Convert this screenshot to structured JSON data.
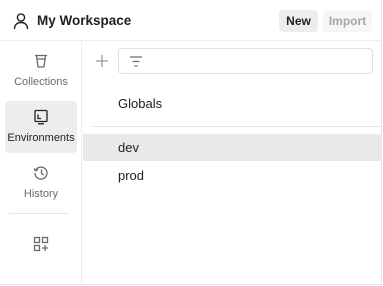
{
  "header": {
    "workspace_title": "My Workspace",
    "new_label": "New",
    "import_label": "Import",
    "workspace_icon": "user-icon"
  },
  "sidebar": {
    "items": [
      {
        "label": "Collections",
        "icon": "trash-can-icon",
        "active": false
      },
      {
        "label": "Environments",
        "icon": "environment-icon",
        "active": true
      },
      {
        "label": "History",
        "icon": "history-icon",
        "active": false
      }
    ],
    "configure_icon": "add-widget-icon"
  },
  "main": {
    "add_icon": "plus-icon",
    "filter_icon": "filter-icon",
    "globals_label": "Globals",
    "environments": [
      {
        "name": "dev",
        "selected": true
      },
      {
        "name": "prod",
        "selected": false
      }
    ]
  },
  "colors": {
    "active_bg": "#ededed",
    "selected_row_bg": "#e9e9e9",
    "text": "#212121",
    "muted_text": "#6b6b6b",
    "disabled_text": "#a6a6a6"
  }
}
